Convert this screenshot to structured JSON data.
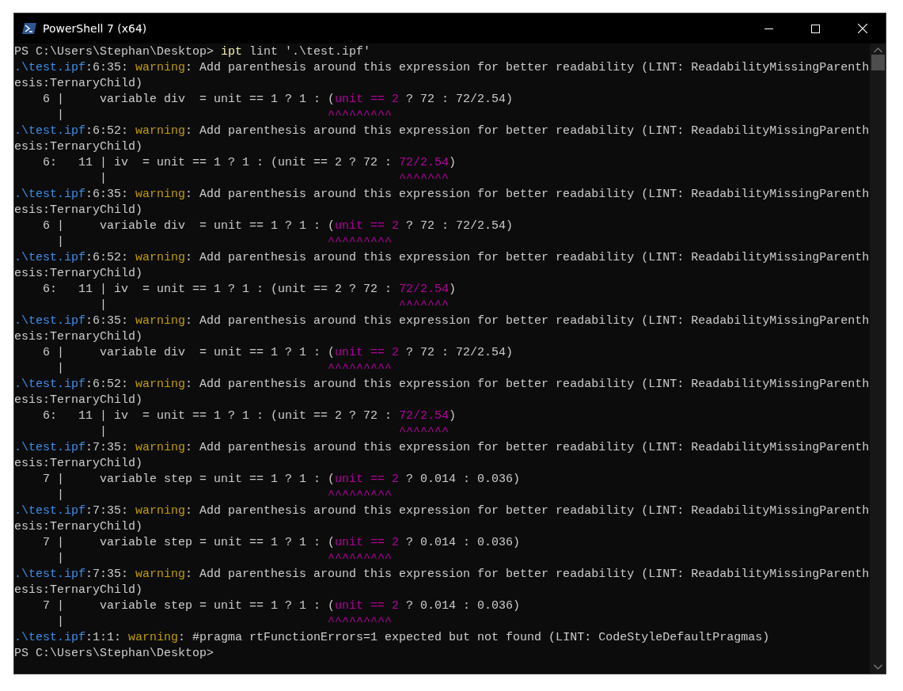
{
  "window": {
    "title": "PowerShell 7 (x64)"
  },
  "lines": [
    {
      "segments": [
        {
          "text": "PS C:\\Users\\Stephan\\Desktop> ",
          "kind": "plain"
        },
        {
          "text": "ipt",
          "kind": "command"
        },
        {
          "text": " lint '.\\test.ipf'",
          "kind": "plain"
        }
      ]
    },
    {
      "segments": [
        {
          "text": ".\\test.ipf",
          "kind": "path"
        },
        {
          "text": ":6:35: ",
          "kind": "plain"
        },
        {
          "text": "warning",
          "kind": "warning"
        },
        {
          "text": ": Add parenthesis around this expression for better readability (LINT: ReadabilityMissingParenth",
          "kind": "plain"
        }
      ]
    },
    {
      "segments": [
        {
          "text": "esis:TernaryChild)",
          "kind": "plain"
        }
      ]
    },
    {
      "segments": [
        {
          "text": "    6 |     variable div  = unit == 1 ? 1 : (",
          "kind": "plain"
        },
        {
          "text": "unit == 2",
          "kind": "highlight"
        },
        {
          "text": " ? 72 : 72/2.54)",
          "kind": "plain"
        }
      ]
    },
    {
      "segments": [
        {
          "text": "      |                                     ",
          "kind": "plain"
        },
        {
          "text": "^^^^^^^^^",
          "kind": "highlight"
        }
      ]
    },
    {
      "segments": [
        {
          "text": ".\\test.ipf",
          "kind": "path"
        },
        {
          "text": ":6:52: ",
          "kind": "plain"
        },
        {
          "text": "warning",
          "kind": "warning"
        },
        {
          "text": ": Add parenthesis around this expression for better readability (LINT: ReadabilityMissingParenth",
          "kind": "plain"
        }
      ]
    },
    {
      "segments": [
        {
          "text": "esis:TernaryChild)",
          "kind": "plain"
        }
      ]
    },
    {
      "segments": [
        {
          "text": "    6:   11 | iv  = unit == 1 ? 1 : (unit == 2 ? 72 : ",
          "kind": "plain"
        },
        {
          "text": "72/2.54",
          "kind": "highlight"
        },
        {
          "text": ")",
          "kind": "plain"
        }
      ]
    },
    {
      "segments": [
        {
          "text": "            |                                         ",
          "kind": "plain"
        },
        {
          "text": "^^^^^^^",
          "kind": "highlight"
        }
      ]
    },
    {
      "segments": [
        {
          "text": ".\\test.ipf",
          "kind": "path"
        },
        {
          "text": ":6:35: ",
          "kind": "plain"
        },
        {
          "text": "warning",
          "kind": "warning"
        },
        {
          "text": ": Add parenthesis around this expression for better readability (LINT: ReadabilityMissingParenth",
          "kind": "plain"
        }
      ]
    },
    {
      "segments": [
        {
          "text": "esis:TernaryChild)",
          "kind": "plain"
        }
      ]
    },
    {
      "segments": [
        {
          "text": "    6 |     variable div  = unit == 1 ? 1 : (",
          "kind": "plain"
        },
        {
          "text": "unit == 2",
          "kind": "highlight"
        },
        {
          "text": " ? 72 : 72/2.54)",
          "kind": "plain"
        }
      ]
    },
    {
      "segments": [
        {
          "text": "      |                                     ",
          "kind": "plain"
        },
        {
          "text": "^^^^^^^^^",
          "kind": "highlight"
        }
      ]
    },
    {
      "segments": [
        {
          "text": ".\\test.ipf",
          "kind": "path"
        },
        {
          "text": ":6:52: ",
          "kind": "plain"
        },
        {
          "text": "warning",
          "kind": "warning"
        },
        {
          "text": ": Add parenthesis around this expression for better readability (LINT: ReadabilityMissingParenth",
          "kind": "plain"
        }
      ]
    },
    {
      "segments": [
        {
          "text": "esis:TernaryChild)",
          "kind": "plain"
        }
      ]
    },
    {
      "segments": [
        {
          "text": "    6:   11 | iv  = unit == 1 ? 1 : (unit == 2 ? 72 : ",
          "kind": "plain"
        },
        {
          "text": "72/2.54",
          "kind": "highlight"
        },
        {
          "text": ")",
          "kind": "plain"
        }
      ]
    },
    {
      "segments": [
        {
          "text": "            |                                         ",
          "kind": "plain"
        },
        {
          "text": "^^^^^^^",
          "kind": "highlight"
        }
      ]
    },
    {
      "segments": [
        {
          "text": ".\\test.ipf",
          "kind": "path"
        },
        {
          "text": ":6:35: ",
          "kind": "plain"
        },
        {
          "text": "warning",
          "kind": "warning"
        },
        {
          "text": ": Add parenthesis around this expression for better readability (LINT: ReadabilityMissingParenth",
          "kind": "plain"
        }
      ]
    },
    {
      "segments": [
        {
          "text": "esis:TernaryChild)",
          "kind": "plain"
        }
      ]
    },
    {
      "segments": [
        {
          "text": "    6 |     variable div  = unit == 1 ? 1 : (",
          "kind": "plain"
        },
        {
          "text": "unit == 2",
          "kind": "highlight"
        },
        {
          "text": " ? 72 : 72/2.54)",
          "kind": "plain"
        }
      ]
    },
    {
      "segments": [
        {
          "text": "      |                                     ",
          "kind": "plain"
        },
        {
          "text": "^^^^^^^^^",
          "kind": "highlight"
        }
      ]
    },
    {
      "segments": [
        {
          "text": ".\\test.ipf",
          "kind": "path"
        },
        {
          "text": ":6:52: ",
          "kind": "plain"
        },
        {
          "text": "warning",
          "kind": "warning"
        },
        {
          "text": ": Add parenthesis around this expression for better readability (LINT: ReadabilityMissingParenth",
          "kind": "plain"
        }
      ]
    },
    {
      "segments": [
        {
          "text": "esis:TernaryChild)",
          "kind": "plain"
        }
      ]
    },
    {
      "segments": [
        {
          "text": "    6:   11 | iv  = unit == 1 ? 1 : (unit == 2 ? 72 : ",
          "kind": "plain"
        },
        {
          "text": "72/2.54",
          "kind": "highlight"
        },
        {
          "text": ")",
          "kind": "plain"
        }
      ]
    },
    {
      "segments": [
        {
          "text": "            |                                         ",
          "kind": "plain"
        },
        {
          "text": "^^^^^^^",
          "kind": "highlight"
        }
      ]
    },
    {
      "segments": [
        {
          "text": ".\\test.ipf",
          "kind": "path"
        },
        {
          "text": ":7:35: ",
          "kind": "plain"
        },
        {
          "text": "warning",
          "kind": "warning"
        },
        {
          "text": ": Add parenthesis around this expression for better readability (LINT: ReadabilityMissingParenth",
          "kind": "plain"
        }
      ]
    },
    {
      "segments": [
        {
          "text": "esis:TernaryChild)",
          "kind": "plain"
        }
      ]
    },
    {
      "segments": [
        {
          "text": "    7 |     variable step = unit == 1 ? 1 : (",
          "kind": "plain"
        },
        {
          "text": "unit == 2",
          "kind": "highlight"
        },
        {
          "text": " ? 0.014 : 0.036)",
          "kind": "plain"
        }
      ]
    },
    {
      "segments": [
        {
          "text": "      |                                     ",
          "kind": "plain"
        },
        {
          "text": "^^^^^^^^^",
          "kind": "highlight"
        }
      ]
    },
    {
      "segments": [
        {
          "text": ".\\test.ipf",
          "kind": "path"
        },
        {
          "text": ":7:35: ",
          "kind": "plain"
        },
        {
          "text": "warning",
          "kind": "warning"
        },
        {
          "text": ": Add parenthesis around this expression for better readability (LINT: ReadabilityMissingParenth",
          "kind": "plain"
        }
      ]
    },
    {
      "segments": [
        {
          "text": "esis:TernaryChild)",
          "kind": "plain"
        }
      ]
    },
    {
      "segments": [
        {
          "text": "    7 |     variable step = unit == 1 ? 1 : (",
          "kind": "plain"
        },
        {
          "text": "unit == 2",
          "kind": "highlight"
        },
        {
          "text": " ? 0.014 : 0.036)",
          "kind": "plain"
        }
      ]
    },
    {
      "segments": [
        {
          "text": "      |                                     ",
          "kind": "plain"
        },
        {
          "text": "^^^^^^^^^",
          "kind": "highlight"
        }
      ]
    },
    {
      "segments": [
        {
          "text": ".\\test.ipf",
          "kind": "path"
        },
        {
          "text": ":7:35: ",
          "kind": "plain"
        },
        {
          "text": "warning",
          "kind": "warning"
        },
        {
          "text": ": Add parenthesis around this expression for better readability (LINT: ReadabilityMissingParenth",
          "kind": "plain"
        }
      ]
    },
    {
      "segments": [
        {
          "text": "esis:TernaryChild)",
          "kind": "plain"
        }
      ]
    },
    {
      "segments": [
        {
          "text": "    7 |     variable step = unit == 1 ? 1 : (",
          "kind": "plain"
        },
        {
          "text": "unit == 2",
          "kind": "highlight"
        },
        {
          "text": " ? 0.014 : 0.036)",
          "kind": "plain"
        }
      ]
    },
    {
      "segments": [
        {
          "text": "      |                                     ",
          "kind": "plain"
        },
        {
          "text": "^^^^^^^^^",
          "kind": "highlight"
        }
      ]
    },
    {
      "segments": [
        {
          "text": ".\\test.ipf",
          "kind": "path"
        },
        {
          "text": ":1:1: ",
          "kind": "plain"
        },
        {
          "text": "warning",
          "kind": "warning"
        },
        {
          "text": ": #pragma rtFunctionErrors=1 expected but not found (LINT: CodeStyleDefaultPragmas)",
          "kind": "plain"
        }
      ]
    },
    {
      "segments": [
        {
          "text": "PS C:\\Users\\Stephan\\Desktop>",
          "kind": "plain"
        }
      ]
    }
  ]
}
